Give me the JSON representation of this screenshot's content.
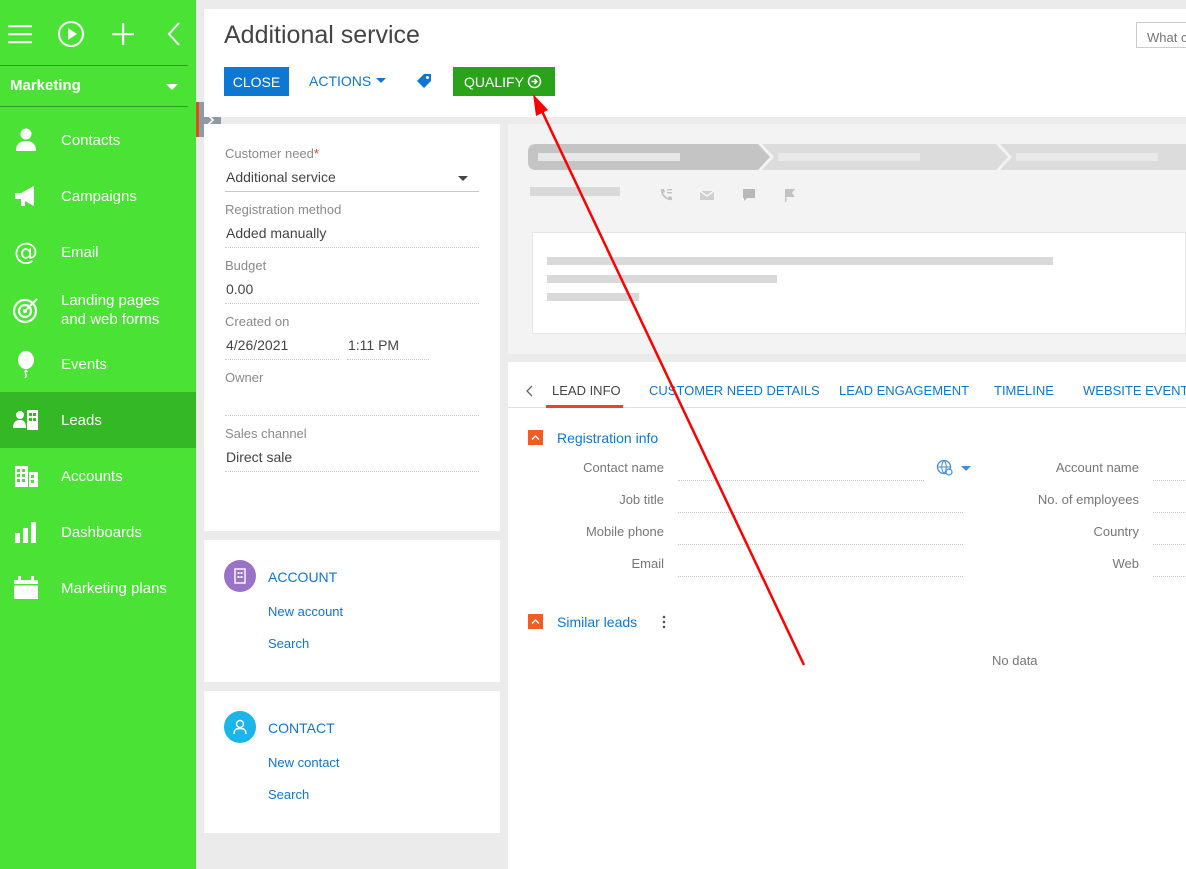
{
  "sidebar": {
    "section_label": "Marketing",
    "items": [
      {
        "label": "Contacts",
        "icon": "person-icon"
      },
      {
        "label": "Campaigns",
        "icon": "megaphone-icon"
      },
      {
        "label": "Email",
        "icon": "at-icon"
      },
      {
        "label": "Landing pages and web forms",
        "line1": "Landing pages",
        "line2": "and web forms",
        "icon": "target-icon"
      },
      {
        "label": "Events",
        "icon": "balloon-icon"
      },
      {
        "label": "Leads",
        "icon": "leads-icon",
        "active": true
      },
      {
        "label": "Accounts",
        "icon": "buildings-icon"
      },
      {
        "label": "Dashboards",
        "icon": "bar-chart-icon"
      },
      {
        "label": "Marketing plans",
        "icon": "calendar-icon"
      }
    ],
    "colors": {
      "background": "#4be236",
      "active": "#35b826"
    }
  },
  "header": {
    "title": "Additional service",
    "search_placeholder": "What c",
    "close_label": "CLOSE",
    "actions_label": "ACTIONS",
    "qualify_label": "QUALIFY"
  },
  "fields": {
    "customer_need_label": "Customer need",
    "customer_need_required": "*",
    "customer_need_value": "Additional service",
    "registration_method_label": "Registration method",
    "registration_method_value": "Added manually",
    "budget_label": "Budget",
    "budget_value": "0.00",
    "created_on_label": "Created on",
    "created_on_date": "4/26/2021",
    "created_on_time": "1:11 PM",
    "owner_label": "Owner",
    "owner_value": "",
    "sales_channel_label": "Sales channel",
    "sales_channel_value": "Direct sale"
  },
  "account_card": {
    "title": "ACCOUNT",
    "new_link": "New account",
    "search_link": "Search"
  },
  "contact_card": {
    "title": "CONTACT",
    "new_link": "New contact",
    "search_link": "Search"
  },
  "tabs": [
    "LEAD INFO",
    "CUSTOMER NEED DETAILS",
    "LEAD ENGAGEMENT",
    "TIMELINE",
    "WEBSITE EVENTS"
  ],
  "registration_info": {
    "title": "Registration info",
    "left_labels": [
      "Contact name",
      "Job title",
      "Mobile phone",
      "Email"
    ],
    "right_labels": [
      "Account name",
      "No. of employees",
      "Country",
      "Web"
    ]
  },
  "similar_leads": {
    "title": "Similar leads",
    "empty_text": "No data"
  },
  "colors": {
    "primary": "#0d77d1",
    "qualify": "#2aa31b",
    "accent": "#f35b24",
    "annotation_arrow": "#ff0000"
  }
}
